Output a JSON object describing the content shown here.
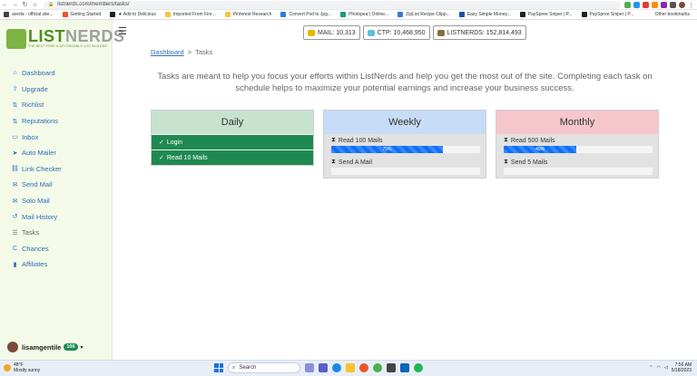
{
  "browser": {
    "url": "listnerds.com/members/tasks/",
    "bookmarks": [
      {
        "label": "aveda - official site...",
        "color": "#444"
      },
      {
        "label": "Getting Started",
        "color": "#e8562a"
      },
      {
        "label": "★ Add to Delicious",
        "color": "#222"
      },
      {
        "label": "Imported From Fire...",
        "color": "#f2c744"
      },
      {
        "label": "Pinterest Research",
        "color": "#f2c744"
      },
      {
        "label": "Convert Pxd to Jpg...",
        "color": "#2a7de1"
      },
      {
        "label": "Photopea | Online...",
        "color": "#1a9c7a"
      },
      {
        "label": "ZipList Recipe Clipp...",
        "color": "#3a7bd5"
      },
      {
        "label": "Easy Simple Money...",
        "color": "#1a4fb0"
      },
      {
        "label": "PaySpree Sniper | P...",
        "color": "#222"
      },
      {
        "label": "PaySpree Sniper | P...",
        "color": "#222"
      }
    ],
    "other_bookmarks": "Other bookmarks"
  },
  "sidebar": {
    "logo_part1": "LIST",
    "logo_part2": "NERDS",
    "logo_tagline": "THE BEST FREE & AFFORDABLE LIST BUILDER",
    "items": [
      {
        "label": "Dashboard",
        "icon": "home-icon",
        "glyph": "⌂"
      },
      {
        "label": "Upgrade",
        "icon": "upgrade-icon",
        "glyph": "⇪"
      },
      {
        "label": "Richlist",
        "icon": "sort-icon",
        "glyph": "⇅"
      },
      {
        "label": "Reputations",
        "icon": "sort-icon",
        "glyph": "⇅"
      },
      {
        "label": "Inbox",
        "icon": "inbox-icon",
        "glyph": "▭"
      },
      {
        "label": "Auto Mailer",
        "icon": "send-icon",
        "glyph": "➤"
      },
      {
        "label": "Link Checker",
        "icon": "link-icon",
        "glyph": "⛓"
      },
      {
        "label": "Send Mail",
        "icon": "mail-icon",
        "glyph": "✉"
      },
      {
        "label": "Solo Mail",
        "icon": "mail-icon",
        "glyph": "✉"
      },
      {
        "label": "Mail History",
        "icon": "history-icon",
        "glyph": "↺"
      },
      {
        "label": "Tasks",
        "icon": "tasks-icon",
        "glyph": "☰"
      },
      {
        "label": "Chances",
        "icon": "chances-icon",
        "glyph": "C"
      },
      {
        "label": "Affiliates",
        "icon": "chart-icon",
        "glyph": "▮"
      }
    ],
    "user_name": "lisamgentile",
    "user_level": "100"
  },
  "header": {
    "stats": [
      {
        "label": "MAIL: 10,313",
        "icon": "coin-icon",
        "color": "#e6b800"
      },
      {
        "label": "CTP: 10,468,950",
        "icon": "gem-icon",
        "color": "#5bc0de"
      },
      {
        "label": "LISTNERDS: 152,814,493",
        "icon": "nerd-icon",
        "color": "#8a6d3b"
      }
    ]
  },
  "breadcrumb": {
    "home": "Dashboard",
    "current": "Tasks"
  },
  "intro": "Tasks are meant to help you focus your efforts within ListNerds and help you get the most out of the site. Completing each task on schedule helps to maximize your potential earnings and increase your business success.",
  "panels": [
    {
      "title": "Daily",
      "head_color": "#c7e2cf",
      "tasks": [
        {
          "label": "Login",
          "done": true
        },
        {
          "label": "Read 10 Mails",
          "done": true
        }
      ]
    },
    {
      "title": "Weekly",
      "head_color": "#c6dcf7",
      "tasks": [
        {
          "label": "Read 100 Mails",
          "done": false,
          "progress": 75,
          "progress_label": "75%"
        },
        {
          "label": "Send A Mail",
          "done": false,
          "progress": 0,
          "progress_label": ""
        }
      ]
    },
    {
      "title": "Monthly",
      "head_color": "#f5c6cc",
      "tasks": [
        {
          "label": "Read 500 Mails",
          "done": false,
          "progress": 49,
          "progress_label": "49%"
        },
        {
          "label": "Send 5 Mails",
          "done": false,
          "progress": 0,
          "progress_label": ""
        }
      ]
    }
  ],
  "taskbar": {
    "weather_temp": "48°F",
    "weather_desc": "Mostly sunny",
    "search_placeholder": "Search",
    "time": "7:56 AM",
    "date": "5/18/2023"
  }
}
